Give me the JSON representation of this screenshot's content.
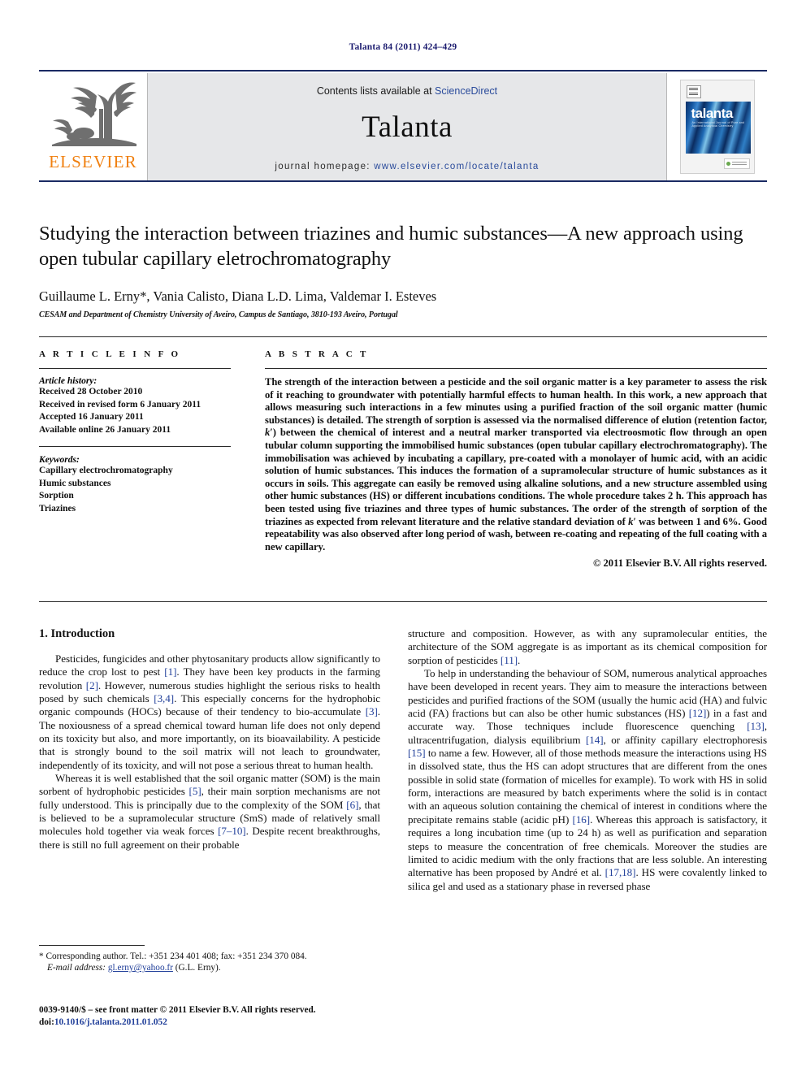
{
  "running_head": "Talanta 84 (2011) 424–429",
  "masthead": {
    "contents_prefix": "Contents lists available at ",
    "contents_link": "ScienceDirect",
    "journal_name": "Talanta",
    "homepage_prefix": "journal homepage:",
    "homepage_url": "www.elsevier.com/locate/talanta",
    "publisher_logo_text": "ELSEVIER",
    "cover_title": "talanta",
    "cover_subtitle": "An International Journal of Pure and Applied Analytical Chemistry"
  },
  "article": {
    "title": "Studying the interaction between triazines and humic substances—A new approach using open tubular capillary eletrochromatography",
    "authors": "Guillaume L. Erny*, Vania Calisto, Diana L.D. Lima, Valdemar I. Esteves",
    "affiliation": "CESAM and Department of Chemistry University of Aveiro, Campus de Santiago, 3810-193 Aveiro, Portugal"
  },
  "article_info": {
    "heading": "A R T I C L E   I N F O",
    "history_label": "Article history:",
    "history": [
      "Received 28 October 2010",
      "Received in revised form 6 January 2011",
      "Accepted 16 January 2011",
      "Available online 26 January 2011"
    ],
    "keywords_label": "Keywords:",
    "keywords": [
      "Capillary electrochromatography",
      "Humic substances",
      "Sorption",
      "Triazines"
    ]
  },
  "abstract": {
    "heading": "A B S T R A C T",
    "paragraph_1": "The strength of the interaction between a pesticide and the soil organic matter is a key parameter to assess the risk of it reaching to groundwater with potentially harmful effects to human health. In this work, a new approach that allows measuring such interactions in a few minutes using a purified fraction of the soil organic matter (humic substances) is detailed. The strength of sorption is assessed via the normalised difference of elution (retention factor, ",
    "k_italic_1": "k",
    "paragraph_2": "′) between the chemical of interest and a neutral marker transported via electroosmotic flow through an open tubular column supporting the immobilised humic substances (open tubular capillary electrochromatography). The immobilisation was achieved by incubating a capillary, pre-coated with a monolayer of humic acid, with an acidic solution of humic substances. This induces the formation of a supramolecular structure of humic substances as it occurs in soils. This aggregate can easily be removed using alkaline solutions, and a new structure assembled using other humic substances (HS) or different incubations conditions. The whole procedure takes 2 h. This approach has been tested using five triazines and three types of humic substances. The order of the strength of sorption of the triazines as expected from relevant literature and the relative standard deviation of ",
    "k_italic_2": "k",
    "paragraph_3": "′ was between 1 and 6%. Good repeatability was also observed after long period of wash, between re-coating and repeating of the full coating with a new capillary.",
    "copyright": "© 2011 Elsevier B.V. All rights reserved."
  },
  "introduction": {
    "heading": "1.  Introduction",
    "left_par_1_a": "Pesticides, fungicides and other phytosanitary products allow significantly to reduce the crop lost to pest ",
    "left_ref_1": "[1]",
    "left_par_1_b": ". They have been key products in the farming revolution ",
    "left_ref_2": "[2]",
    "left_par_1_c": ". However, numerous studies highlight the serious risks to health posed by such chemicals ",
    "left_ref_3": "[3,4]",
    "left_par_1_d": ". This especially concerns for the hydrophobic organic compounds (HOCs) because of their tendency to bio-accumulate ",
    "left_ref_4": "[3]",
    "left_par_1_e": ". The noxiousness of a spread chemical toward human life does not only depend on its toxicity but also, and more importantly, on its bioavailability. A pesticide that is strongly bound to the soil matrix will not leach to groundwater, independently of its toxicity, and will not pose a serious threat to human health.",
    "left_par_2_a": "Whereas it is well established that the soil organic matter (SOM) is the main sorbent of hydrophobic pesticides ",
    "left_ref_5": "[5]",
    "left_par_2_b": ", their main sorption mechanisms are not fully understood. This is principally due to the complexity of the SOM ",
    "left_ref_6": "[6]",
    "left_par_2_c": ", that is believed to be a supramolecular structure (SmS) made of relatively small molecules hold together via weak forces ",
    "left_ref_7": "[7–10]",
    "left_par_2_d": ". Despite recent breakthroughs, there is still no full agreement on their probable",
    "right_par_1_a": "structure and composition. However, as with any supramolecular entities, the architecture of the SOM aggregate is as important as its chemical composition for sorption of pesticides ",
    "right_ref_11": "[11]",
    "right_par_1_b": ".",
    "right_par_2_a": "To help in understanding the behaviour of SOM, numerous analytical approaches have been developed in recent years. They aim to measure the interactions between pesticides and purified fractions of the SOM (usually the humic acid (HA) and fulvic acid (FA) fractions but can also be other humic substances (HS) ",
    "right_ref_12": "[12]",
    "right_par_2_b": ") in a fast and accurate way. Those techniques include fluorescence quenching ",
    "right_ref_13": "[13]",
    "right_par_2_c": ", ultracentrifugation, dialysis equilibrium ",
    "right_ref_14": "[14]",
    "right_par_2_d": ", or affinity capillary electrophoresis ",
    "right_ref_15": "[15]",
    "right_par_2_e": " to name a few. However, all of those methods measure the interactions using HS in dissolved state, thus the HS can adopt structures that are different from the ones possible in solid state (formation of micelles for example). To work with HS in solid form, interactions are measured by batch experiments where the solid is in contact with an aqueous solution containing the chemical of interest in conditions where the precipitate remains stable (acidic pH) ",
    "right_ref_16": "[16]",
    "right_par_2_f": ". Whereas this approach is satisfactory, it requires a long incubation time (up to 24 h) as well as purification and separation steps to measure the concentration of free chemicals. Moreover the studies are limited to acidic medium with the only fractions that are less soluble. An interesting alternative has been proposed by André et al. ",
    "right_ref_1718": "[17,18]",
    "right_par_2_g": ". HS were covalently linked to silica gel and used as a stationary phase in reversed phase"
  },
  "footnotes": {
    "corresponding": "* Corresponding author. Tel.: +351 234 401 408; fax: +351 234 370 084.",
    "email_label": "E-mail address:",
    "email": "gl.erny@yahoo.fr",
    "email_suffix": " (G.L. Erny).",
    "issn_line": "0039-9140/$ – see front matter © 2011 Elsevier B.V. All rights reserved.",
    "doi_label": "doi:",
    "doi": "10.1016/j.talanta.2011.01.052"
  },
  "colors": {
    "running_head": "#1a1a6e",
    "link": "#2a4b9b",
    "reference": "#22409a",
    "elsevier_orange": "#f08010",
    "masthead_bg": "#e6e7e9",
    "rule": "#1a2a63"
  }
}
